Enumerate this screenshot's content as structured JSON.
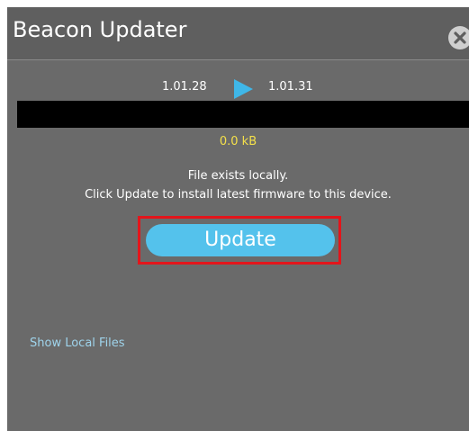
{
  "window": {
    "title": "Beacon Updater",
    "close_icon": "close-icon"
  },
  "versions": {
    "current": "1.01.28",
    "arrow_icon": "play-arrow-icon",
    "latest": "1.01.31",
    "arrow_color": "#3fb7e8"
  },
  "progress": {
    "fraction": 0,
    "size_label": "0.0 kB",
    "size_color": "#f4e04a"
  },
  "message": {
    "line1": "File exists locally.",
    "line2": "Click Update to install latest firmware to this device."
  },
  "update_button": {
    "label": "Update",
    "color": "#54c2ec",
    "highlight_color": "#e3151b"
  },
  "footer": {
    "show_local_files": "Show Local Files"
  }
}
